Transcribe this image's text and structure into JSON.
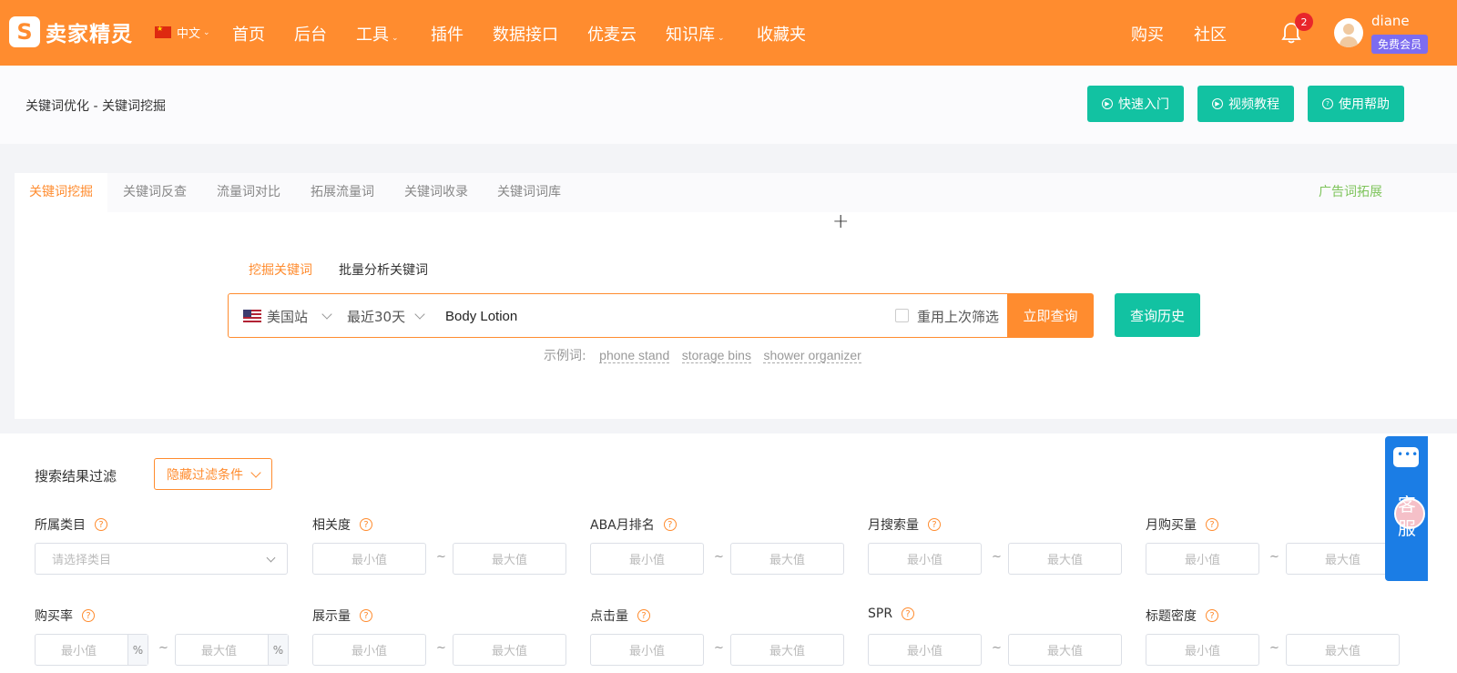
{
  "topnav": {
    "logo_text": "卖家精灵",
    "lang": "中文",
    "items": [
      "首页",
      "后台",
      "工具",
      "插件",
      "数据接口",
      "优麦云",
      "知识库",
      "收藏夹"
    ],
    "right_items": [
      "购买",
      "社区"
    ],
    "notification_count": "2",
    "username": "diane",
    "member_badge": "免费会员"
  },
  "breadcrumb": "关键词优化 - 关键词挖掘",
  "help_buttons": [
    "快速入门",
    "视频教程",
    "使用帮助"
  ],
  "tabs": [
    "关键词挖掘",
    "关键词反查",
    "流量词对比",
    "拓展流量词",
    "关键词收录",
    "关键词词库"
  ],
  "tab_right": "广告词拓展",
  "search": {
    "modes": [
      "挖掘关键词",
      "批量分析关键词"
    ],
    "marketplace": "美国站",
    "period": "最近30天",
    "keyword": "Body Lotion",
    "reuse_label": "重用上次筛选",
    "query_button": "立即查询",
    "history_button": "查询历史",
    "examples_label": "示例词:",
    "examples": [
      "phone stand",
      "storage bins",
      "shower organizer"
    ]
  },
  "filter": {
    "title": "搜索结果过滤",
    "hide_button": "隐藏过滤条件",
    "category_placeholder": "请选择类目",
    "min_placeholder": "最小值",
    "max_placeholder": "最大值",
    "tilde": "~",
    "percent": "%",
    "row1": [
      "所属类目",
      "相关度",
      "ABA月排名",
      "月搜索量",
      "月购买量"
    ],
    "row2": [
      "购买率",
      "展示量",
      "点击量",
      "SPR",
      "标题密度"
    ]
  },
  "service": {
    "label": "客服"
  },
  "colors": {
    "brand": "#ff8c2f",
    "teal": "#12c2a2",
    "green_link": "#7ec45b",
    "service_blue": "#1b7de5"
  }
}
